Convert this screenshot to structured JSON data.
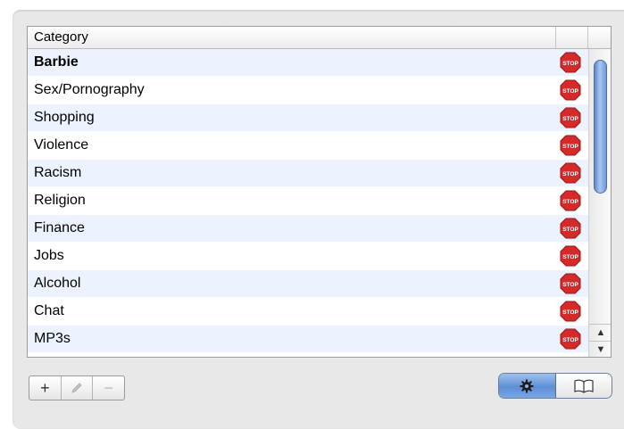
{
  "table": {
    "header": {
      "category_label": "Category"
    },
    "rows": [
      {
        "label": "Barbie",
        "bold": true
      },
      {
        "label": "Sex/Pornography"
      },
      {
        "label": "Shopping"
      },
      {
        "label": "Violence"
      },
      {
        "label": "Racism"
      },
      {
        "label": "Religion"
      },
      {
        "label": "Finance"
      },
      {
        "label": "Jobs"
      },
      {
        "label": "Alcohol"
      },
      {
        "label": "Chat"
      },
      {
        "label": "MP3s"
      }
    ],
    "stop_icon_text": "STOP",
    "stop_icon_color": "#d42a2a"
  },
  "scrollbar": {
    "up_arrow": "▲",
    "down_arrow": "▼"
  },
  "toolbar": {
    "add_label": "+",
    "remove_label": "−",
    "edit_icon": "pencil-icon",
    "view_buttons": [
      {
        "icon": "gear-icon",
        "active": true
      },
      {
        "icon": "book-icon",
        "active": false
      }
    ]
  }
}
